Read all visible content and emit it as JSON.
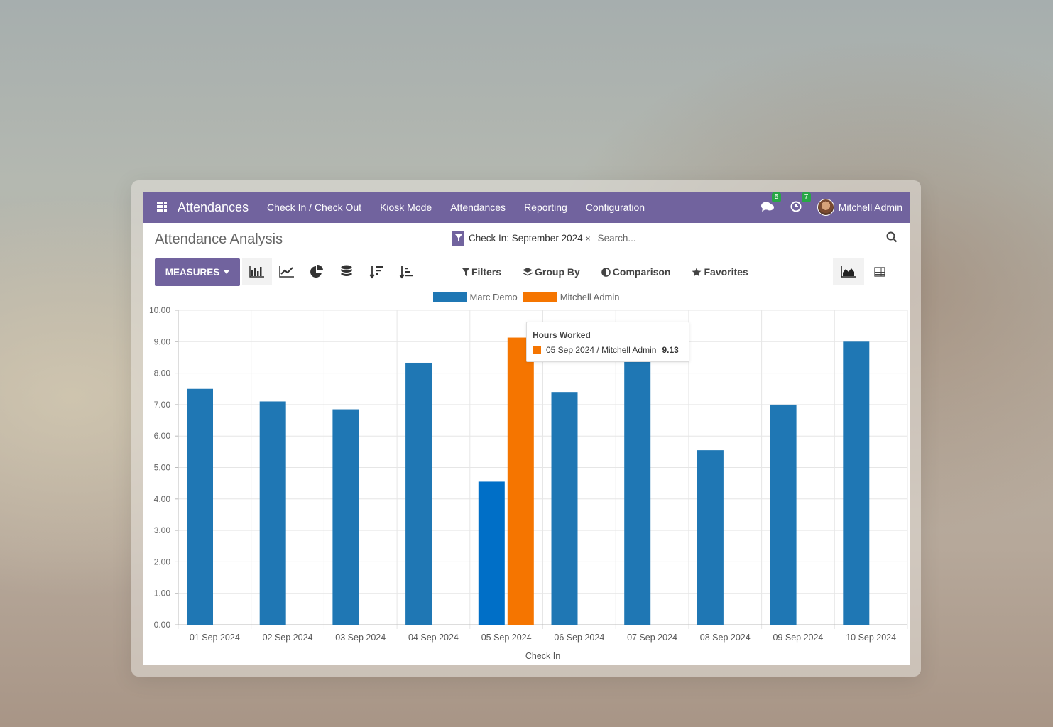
{
  "navbar": {
    "brand": "Attendances",
    "menu": [
      "Check In / Check Out",
      "Kiosk Mode",
      "Attendances",
      "Reporting",
      "Configuration"
    ],
    "messages_badge": "5",
    "activities_badge": "7",
    "user": "Mitchell Admin"
  },
  "control_panel": {
    "title": "Attendance Analysis",
    "facet": "Check In: September 2024",
    "facet_close": "×",
    "search_placeholder": "Search...",
    "measures_label": "MEASURES",
    "filters_label": "Filters",
    "group_by_label": "Group By",
    "comparison_label": "Comparison",
    "favorites_label": "Favorites"
  },
  "colors": {
    "primary": "#71639e",
    "series_marc": "#1f77b4",
    "series_mitchell": "#f57500",
    "hover_bar": "#006fc7"
  },
  "tooltip": {
    "title": "Hours Worked",
    "label": "05 Sep 2024 / Mitchell Admin",
    "value": "9.13"
  },
  "chart_data": {
    "type": "bar",
    "categories": [
      "01 Sep 2024",
      "02 Sep 2024",
      "03 Sep 2024",
      "04 Sep 2024",
      "05 Sep 2024",
      "06 Sep 2024",
      "07 Sep 2024",
      "08 Sep 2024",
      "09 Sep 2024",
      "10 Sep 2024"
    ],
    "series": [
      {
        "name": "Marc Demo",
        "values": [
          7.5,
          7.1,
          6.85,
          8.33,
          4.55,
          7.4,
          8.4,
          5.55,
          7.0,
          9.0
        ]
      },
      {
        "name": "Mitchell Admin",
        "values": [
          null,
          null,
          null,
          null,
          9.13,
          null,
          null,
          null,
          null,
          null
        ]
      }
    ],
    "xlabel": "Check In",
    "ylabel": "",
    "ylim": [
      0,
      10
    ],
    "yticks": [
      "0.00",
      "1.00",
      "2.00",
      "3.00",
      "4.00",
      "5.00",
      "6.00",
      "7.00",
      "8.00",
      "9.00",
      "10.00"
    ],
    "legend": "top-center",
    "grid": true
  }
}
